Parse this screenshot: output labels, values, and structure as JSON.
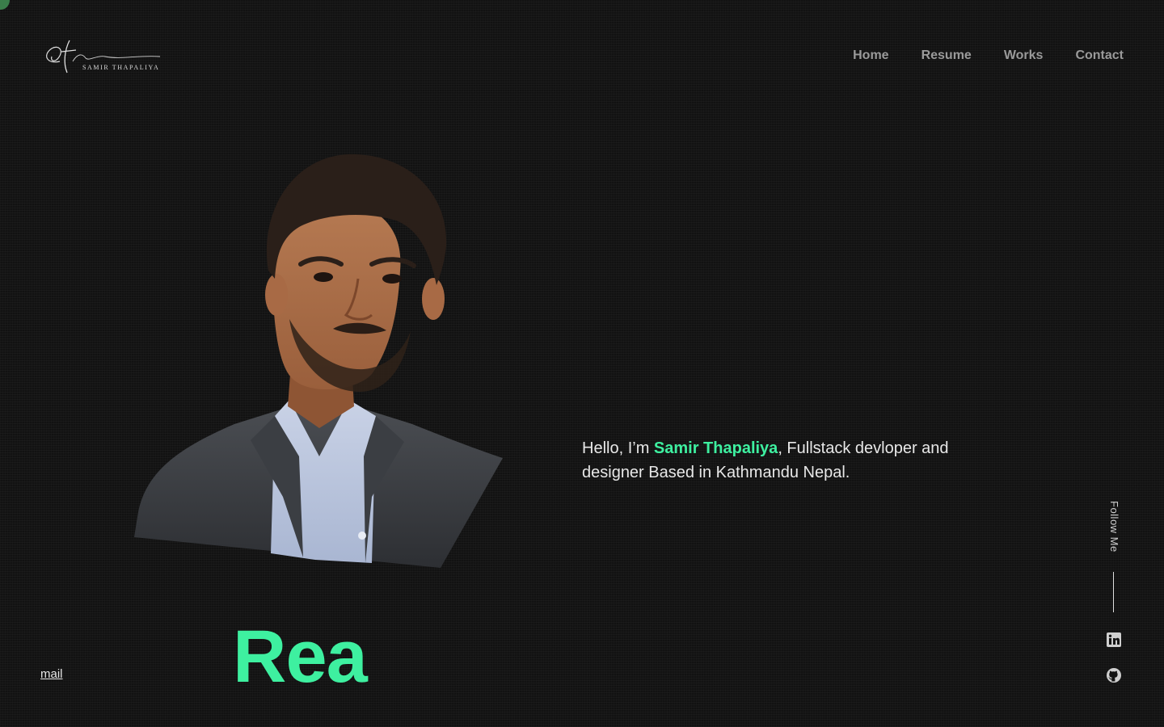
{
  "header": {
    "logo_text": "SAMIR THAPALIYA",
    "nav": [
      {
        "label": "Home"
      },
      {
        "label": "Resume"
      },
      {
        "label": "Works"
      },
      {
        "label": "Contact"
      }
    ]
  },
  "hero": {
    "intro_prefix": "Hello, I’m ",
    "name": "Samir Thapaliya",
    "intro_suffix": ", Fullstack devloper and designer Based in Kathmandu Nepal.",
    "big_word": "Rea",
    "accent_color": "#3ef0a0"
  },
  "footer": {
    "mail_label": "mail"
  },
  "social": {
    "follow_label": "Follow Me",
    "icons": [
      "linkedin-icon",
      "github-icon"
    ]
  },
  "colors": {
    "background": "#121212",
    "accent": "#3ef0a0",
    "nav_text": "#9a9a9a"
  }
}
